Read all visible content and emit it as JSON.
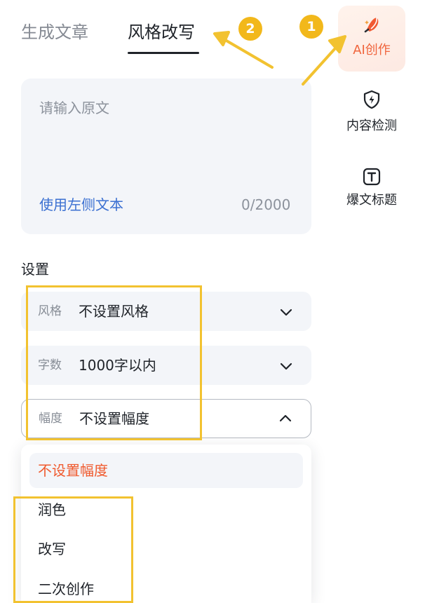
{
  "tabs": [
    {
      "label": "生成文章",
      "active": false
    },
    {
      "label": "风格改写",
      "active": true
    }
  ],
  "input": {
    "placeholder": "请输入原文",
    "use_left_text": "使用左侧文本",
    "counter": "0/2000"
  },
  "settings": {
    "title": "设置",
    "rows": [
      {
        "label": "风格",
        "value": "不设置风格",
        "state": "collapsed"
      },
      {
        "label": "字数",
        "value": "1000字以内",
        "state": "collapsed"
      },
      {
        "label": "幅度",
        "value": "不设置幅度",
        "state": "expanded"
      }
    ]
  },
  "dropdown": {
    "selected": "不设置幅度",
    "options": [
      "润色",
      "改写",
      "二次创作"
    ]
  },
  "sidebar": {
    "items": [
      {
        "label": "AI创作",
        "icon": "pen-nib-icon",
        "active": true
      },
      {
        "label": "内容检测",
        "icon": "lightning-shield-icon",
        "active": false
      },
      {
        "label": "爆文标题",
        "icon": "title-t-icon",
        "active": false
      }
    ]
  },
  "annotations": {
    "badges": [
      "1",
      "2"
    ],
    "highlight_color": "#f2c230"
  },
  "colors": {
    "accent": "#f05a2e",
    "link": "#3a6fd1",
    "panel_bg": "#f3f5f9"
  }
}
